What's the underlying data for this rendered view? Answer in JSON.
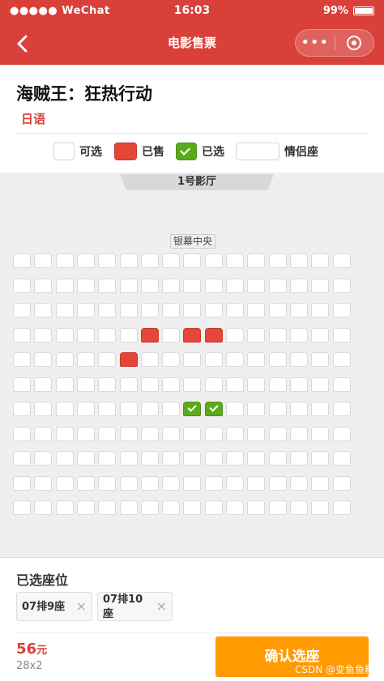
{
  "status_bar": {
    "carrier": "●●●●● WeChat",
    "wifi_icon": "wifi-icon",
    "time": "16:03",
    "battery": "99%"
  },
  "nav": {
    "title": "电影售票",
    "back_icon": "chevron-left-icon",
    "more_label": "•••",
    "close_icon": "target-icon"
  },
  "movie": {
    "title": "海贼王：狂热行动",
    "language": "日语"
  },
  "legend": {
    "available": "可选",
    "sold": "已售",
    "selected": "已选",
    "couple": "情侣座"
  },
  "hall": {
    "name": "1号影厅",
    "screen_label": "银幕中央",
    "rows": 11,
    "cols": 16,
    "sold_seats": [
      [
        4,
        7
      ],
      [
        4,
        9
      ],
      [
        4,
        10
      ],
      [
        5,
        6
      ]
    ],
    "selected_seats": [
      [
        7,
        9
      ],
      [
        7,
        10
      ]
    ]
  },
  "selection": {
    "title": "已选座位",
    "chips": [
      {
        "label": "07排9座"
      },
      {
        "label": "07排10座"
      }
    ],
    "close_icon": "×"
  },
  "price": {
    "amount": "56",
    "unit": "元",
    "detail": "28x2"
  },
  "confirm_label": "确认选座",
  "watermark": "CSDN @变鱼鱼籽"
}
